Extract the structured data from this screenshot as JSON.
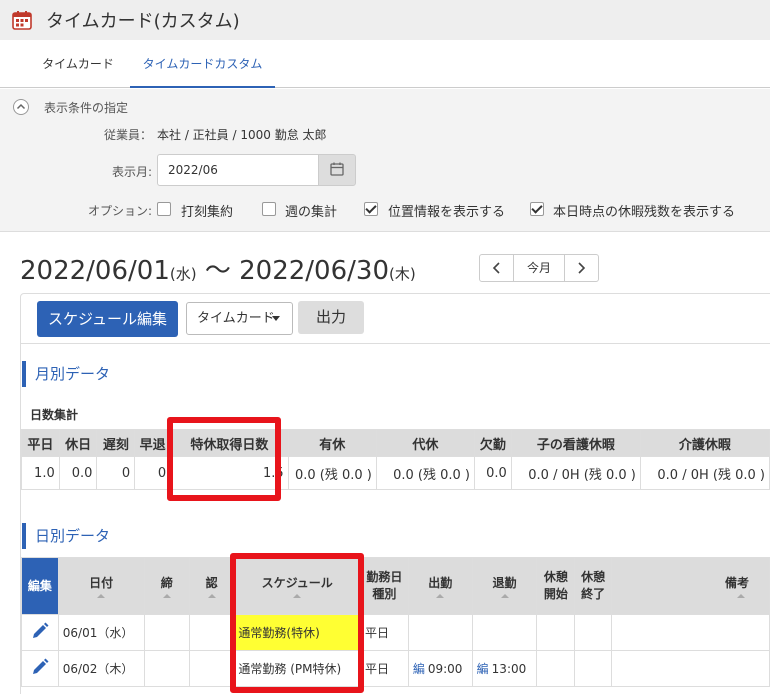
{
  "app": {
    "title": "タイムカード(カスタム)"
  },
  "tabs": [
    {
      "label": "タイムカード",
      "active": false
    },
    {
      "label": "タイムカードカスタム",
      "active": true
    }
  ],
  "filter": {
    "header": "表示条件の指定",
    "employee_label": "従業員：",
    "employee_value": "本社 / 正社員 / 1000 勤怠 太郎",
    "month_label": "表示月:",
    "month_value": "2022/06",
    "options_label": "オプション:",
    "options": [
      {
        "label": "打刻集約",
        "checked": false
      },
      {
        "label": "週の集計",
        "checked": false
      },
      {
        "label": "位置情報を表示する",
        "checked": true
      },
      {
        "label": "本日時点の休暇残数を表示する",
        "checked": true
      }
    ]
  },
  "range": {
    "start": "2022/06/01",
    "start_wd": "(水)",
    "sep": "〜",
    "end": "2022/06/30",
    "end_wd": "(木)",
    "today_label": "今月",
    "prev": "‹",
    "next": "›"
  },
  "toolbar": {
    "schedule_edit": "スケジュール編集",
    "view_select": "タイムカード",
    "output": "出力"
  },
  "monthly": {
    "title": "月別データ",
    "subtitle": "日数集計",
    "headers": [
      "平日",
      "休日",
      "遅刻",
      "早退",
      "特休取得日数",
      "有休",
      "代休",
      "欠勤",
      "子の看護休暇",
      "介護休暇"
    ],
    "values": [
      "1.0",
      "0.0",
      "0",
      "0",
      "1.5",
      "0.0 (残 0.0 )",
      "0.0 (残 0.0 )",
      "0.0",
      "0.0 / 0H (残 0.0 )",
      "0.0 / 0H (残 0.0 )"
    ]
  },
  "daily": {
    "title": "日別データ",
    "headers": {
      "edit": "編集",
      "date": "日付",
      "close": "締",
      "approve": "認",
      "schedule": "スケジュール",
      "daytype1": "勤務日",
      "daytype2": "種別",
      "in": "出勤",
      "out": "退勤",
      "bstart1": "休憩",
      "bstart2": "開始",
      "bend1": "休憩",
      "bend2": "終了",
      "note": "備考"
    },
    "rows": [
      {
        "date": "06/01（水）",
        "schedule": "通常勤務(特休)",
        "daytype": "平日",
        "in_badge": "",
        "in": "",
        "out_badge": "",
        "out": ""
      },
      {
        "date": "06/02（木）",
        "schedule": "通常勤務 (PM特休)",
        "daytype": "平日",
        "in_badge": "編",
        "in": "09:00",
        "out_badge": "編",
        "out": "13:00"
      }
    ]
  },
  "colors": {
    "accent": "#2d62b5",
    "highlight": "#e8141b",
    "schedule_bg": "#ffff33"
  },
  "icons": [
    "calendar-icon",
    "chevron-up-icon",
    "calendar-icon",
    "chevron-left-icon",
    "chevron-right-icon",
    "pencil-icon"
  ]
}
